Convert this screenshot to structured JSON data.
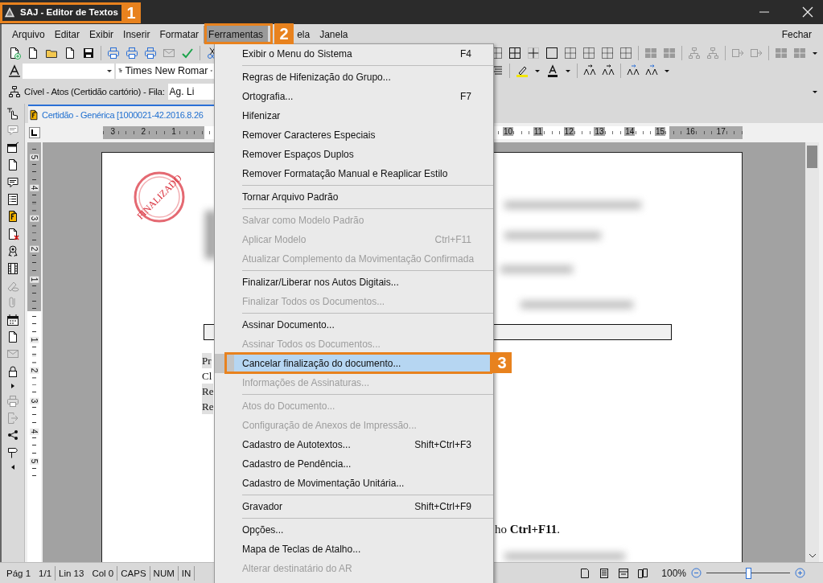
{
  "window": {
    "title": "SAJ - Editor de Textos"
  },
  "callouts": [
    "1",
    "2",
    "3"
  ],
  "menu_bar": {
    "items": [
      {
        "label": "Arquivo",
        "selected": false
      },
      {
        "label": "Editar",
        "selected": false
      },
      {
        "label": "Exibir",
        "selected": false
      },
      {
        "label": "Inserir",
        "selected": false
      },
      {
        "label": "Formatar",
        "selected": false
      },
      {
        "label": "Ferramentas",
        "selected": true
      },
      {
        "label": "ela",
        "selected": false
      },
      {
        "label": "Janela",
        "selected": false
      }
    ],
    "close_label": "Fechar"
  },
  "format_bar": {
    "font_value": "Times New Romar"
  },
  "queue_bar": {
    "label": "Cível - Atos (Certidão cartório) - Fila:",
    "field_value": "Ag. Li"
  },
  "document_tab": {
    "title": "Certidão - Genérica [1000021-42.2016.8.26"
  },
  "ruler": {
    "left_numbers": [
      "3",
      "2",
      "1"
    ],
    "right_numbers": [
      "10",
      "11",
      "12",
      "13",
      "14",
      "15",
      "16",
      "17"
    ]
  },
  "vertical_ruler": {
    "top_numbers": [
      "5",
      "4",
      "3",
      "2",
      "1"
    ],
    "bottom_numbers": [
      "1",
      "2",
      "3",
      "4",
      "5"
    ]
  },
  "document": {
    "stamp": "FINALIZADO",
    "lines": [
      "Pr",
      "Cl",
      "Re",
      "Re"
    ],
    "shortcut_note": "ho **Ctrl+F11**."
  },
  "tools_menu": {
    "items": [
      {
        "kind": "item",
        "label": "Exibir o Menu do Sistema",
        "shortcut": "F4",
        "disabled": false,
        "selected": false
      },
      {
        "kind": "separator"
      },
      {
        "kind": "item",
        "label": "Regras de Hifenização do Grupo...",
        "disabled": false,
        "selected": false
      },
      {
        "kind": "item",
        "label": "Ortografia...",
        "shortcut": "F7",
        "disabled": false,
        "selected": false
      },
      {
        "kind": "item",
        "label": "Hifenizar",
        "disabled": false,
        "selected": false
      },
      {
        "kind": "item",
        "label": "Remover Caracteres Especiais",
        "disabled": false,
        "selected": false
      },
      {
        "kind": "item",
        "label": "Remover Espaços Duplos",
        "disabled": false,
        "selected": false
      },
      {
        "kind": "item",
        "label": "Remover Formatação Manual e Reaplicar Estilo",
        "disabled": false,
        "selected": false
      },
      {
        "kind": "separator"
      },
      {
        "kind": "item",
        "label": "Tornar Arquivo Padrão",
        "disabled": false,
        "selected": false
      },
      {
        "kind": "separator"
      },
      {
        "kind": "item",
        "label": "Salvar como Modelo Padrão",
        "disabled": true,
        "selected": false
      },
      {
        "kind": "item",
        "label": "Aplicar Modelo",
        "shortcut": "Ctrl+F11",
        "disabled": true,
        "selected": false
      },
      {
        "kind": "item",
        "label": "Atualizar Complemento da Movimentação Confirmada",
        "disabled": true,
        "selected": false
      },
      {
        "kind": "separator"
      },
      {
        "kind": "item",
        "label": "Finalizar/Liberar nos Autos Digitais...",
        "disabled": false,
        "selected": false
      },
      {
        "kind": "item",
        "label": "Finalizar Todos os Documentos...",
        "disabled": true,
        "selected": false
      },
      {
        "kind": "separator"
      },
      {
        "kind": "item",
        "label": "Assinar Documento...",
        "disabled": false,
        "selected": false
      },
      {
        "kind": "item",
        "label": "Assinar Todos os Documentos...",
        "disabled": true,
        "selected": false
      },
      {
        "kind": "item",
        "label": "Cancelar finalização do documento...",
        "disabled": false,
        "selected": true
      },
      {
        "kind": "item",
        "label": "Informações de Assinaturas...",
        "disabled": true,
        "selected": false
      },
      {
        "kind": "separator"
      },
      {
        "kind": "item",
        "label": "Atos do Documento...",
        "disabled": true,
        "selected": false
      },
      {
        "kind": "item",
        "label": "Configuração de Anexos de Impressão...",
        "disabled": true,
        "selected": false
      },
      {
        "kind": "item",
        "label": "Cadastro de Autotextos...",
        "shortcut": "Shift+Ctrl+F3",
        "disabled": false,
        "selected": false
      },
      {
        "kind": "item",
        "label": "Cadastro de Pendência...",
        "disabled": false,
        "selected": false
      },
      {
        "kind": "item",
        "label": "Cadastro de Movimentação Unitária...",
        "disabled": false,
        "selected": false
      },
      {
        "kind": "separator"
      },
      {
        "kind": "item",
        "label": "Gravador",
        "shortcut": "Shift+Ctrl+F9",
        "disabled": false,
        "selected": false
      },
      {
        "kind": "separator"
      },
      {
        "kind": "item",
        "label": "Opções...",
        "disabled": false,
        "selected": false
      },
      {
        "kind": "item",
        "label": "Mapa de Teclas de Atalho...",
        "disabled": false,
        "selected": false
      },
      {
        "kind": "item",
        "label": "Alterar destinatário do AR",
        "disabled": true,
        "selected": false
      }
    ]
  },
  "status_bar": {
    "cells": [
      [
        "Pág 1",
        "1/1"
      ],
      [
        "Lin 13",
        "Col 0"
      ],
      [
        "CAPS"
      ],
      [
        "NUM"
      ],
      [
        "IN"
      ]
    ],
    "zoom": "100%",
    "zoom_slider": {
      "level": 0.5
    }
  }
}
